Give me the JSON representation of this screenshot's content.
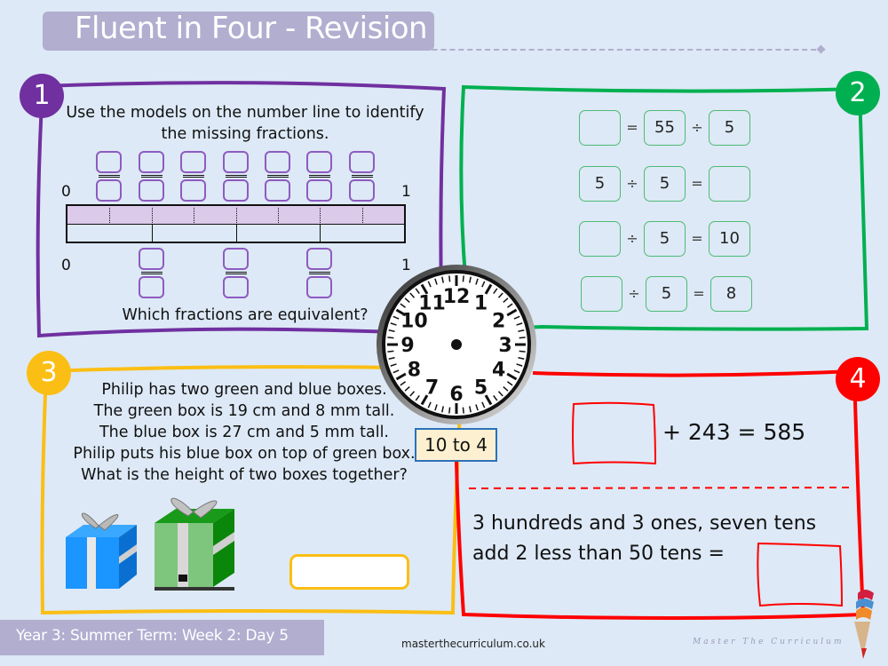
{
  "title": "Fluent in Four - Revision",
  "colors": {
    "background": "#dde9f6",
    "title_bar": "#b1aed0",
    "panel1": "#7030a0",
    "panel2": "#00b050",
    "panel3": "#fbbe14",
    "panel4": "#ff0000",
    "time_label_bg": "#fdf0d0",
    "time_label_border": "#2b72b9"
  },
  "panel1": {
    "number": "1",
    "instruction_line1": "Use the models on the number line to identify",
    "instruction_line2": "the missing fractions.",
    "top_line": {
      "start_label": "0",
      "end_label": "1",
      "missing_fractions": 7
    },
    "bottom_line": {
      "start_label": "0",
      "end_label": "1",
      "missing_fractions": 3
    },
    "bar_model": {
      "top_parts": 8,
      "bottom_parts": 4
    },
    "question": "Which fractions are equivalent?"
  },
  "panel2": {
    "number": "2",
    "equations": [
      {
        "cells": [
          "",
          "=",
          "55",
          "÷",
          "5"
        ]
      },
      {
        "cells": [
          "5",
          "÷",
          "5",
          "=",
          ""
        ]
      },
      {
        "cells": [
          "",
          "÷",
          "5",
          "=",
          "10"
        ]
      },
      {
        "cells": [
          "",
          "÷",
          "5",
          "=",
          "8"
        ]
      }
    ]
  },
  "panel3": {
    "number": "3",
    "lines": [
      "Philip has two green and blue boxes.",
      "The green box is 19 cm and 8 mm tall.",
      "The blue box is 27 cm and 5 mm tall.",
      "Philip puts his blue box on top of green box.",
      "What is the height of two boxes together?"
    ],
    "answer": ""
  },
  "clock": {
    "numbers": [
      "12",
      "1",
      "2",
      "3",
      "4",
      "5",
      "6",
      "7",
      "8",
      "9",
      "10",
      "11"
    ],
    "time_label": "10 to 4"
  },
  "panel4": {
    "number": "4",
    "equation": "+ 243 = 585",
    "word_problem_line1": "3 hundreds and 3 ones, seven tens",
    "word_problem_line2": "add 2 less than 50 tens =",
    "answer1": "",
    "answer2": ""
  },
  "footer": {
    "lesson": "Year 3: Summer Term: Week 2: Day 5",
    "website": "masterthecurriculum.co.uk",
    "brand": "Master The Curriculum"
  }
}
